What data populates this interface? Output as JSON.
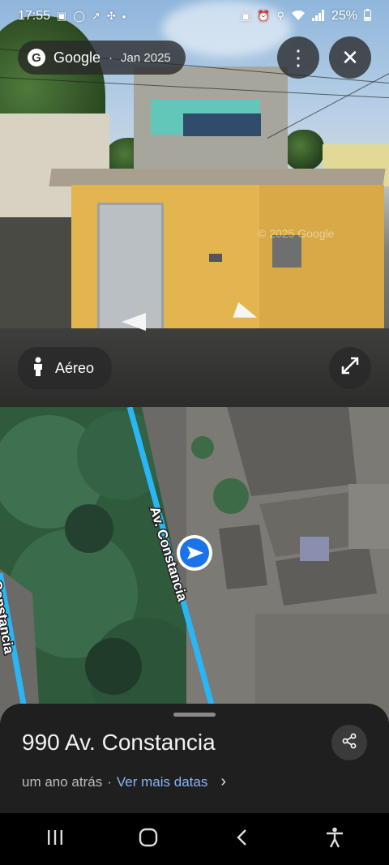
{
  "status_bar": {
    "time": "17:55",
    "battery": "25%",
    "icons": [
      "calendar-icon",
      "whatsapp-icon",
      "trend-icon",
      "fan-icon",
      "dot-icon",
      "photo-icon",
      "alarm-icon",
      "location-icon",
      "wifi-icon",
      "signal-icon",
      "battery-icon"
    ]
  },
  "street_view": {
    "source": "Google",
    "date": "Jan 2025",
    "watermark": "© 2025 Google",
    "aerial_label": "Aéreo",
    "menu_icon": "more-vert-icon",
    "close_icon": "close-icon",
    "expand_icon": "expand-icon"
  },
  "map": {
    "street_label": "Av. Constancia",
    "street_label_side": "Constancia",
    "road_color": "#29b6f6",
    "marker_color": "#1a73e8"
  },
  "place_sheet": {
    "address": "990 Av. Constancia",
    "age": "um ano atrás",
    "separator": "·",
    "more_dates_link": "Ver mais datas",
    "share_icon": "share-icon",
    "link_color": "#8ab4f8"
  },
  "nav_bar": {
    "recents_icon": "recents-icon",
    "home_icon": "home-icon",
    "back_icon": "back-icon",
    "accessibility_icon": "accessibility-icon"
  }
}
